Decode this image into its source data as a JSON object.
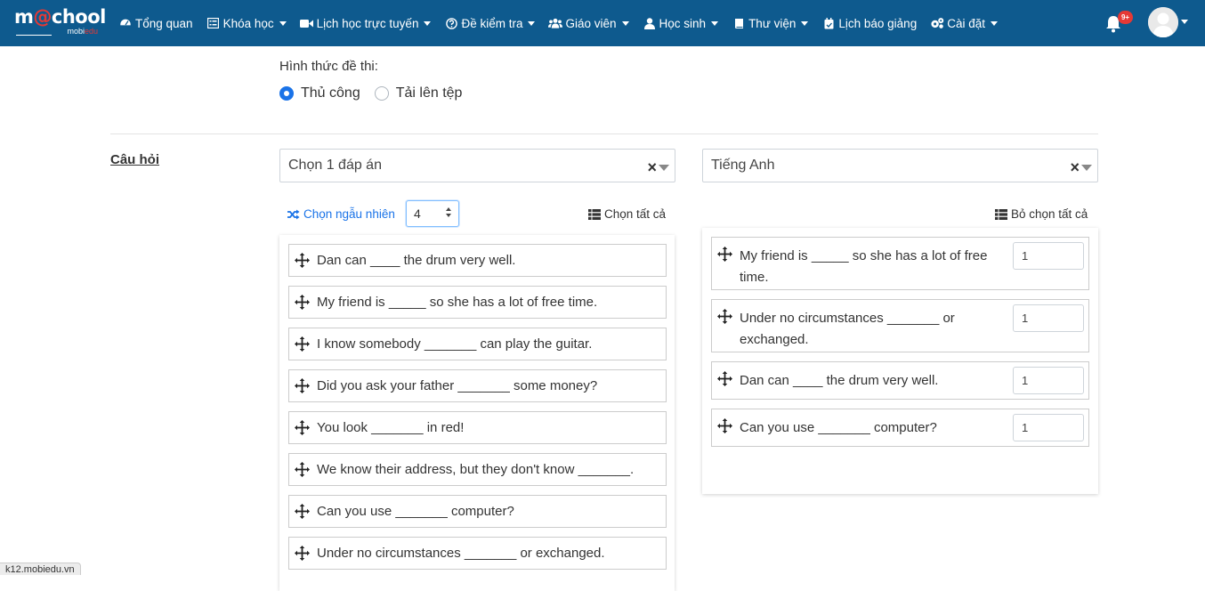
{
  "logo": {
    "brand_start": "m",
    "brand_o": "@",
    "brand_end": "chool",
    "sub_start": "mobi",
    "sub_end": "edu"
  },
  "nav": {
    "items": [
      {
        "label": "Tổng quan",
        "icon": "dashboard-icon",
        "caret": false
      },
      {
        "label": "Khóa học",
        "icon": "list-alt-icon",
        "caret": true
      },
      {
        "label": "Lịch học trực tuyến",
        "icon": "video-camera-icon",
        "caret": true
      },
      {
        "label": "Đề kiểm tra",
        "icon": "question-circle-icon",
        "caret": true
      },
      {
        "label": "Giáo viên",
        "icon": "users-icon",
        "caret": true
      },
      {
        "label": "Học sinh",
        "icon": "user-icon",
        "caret": true
      },
      {
        "label": "Thư viện",
        "icon": "book-icon",
        "caret": true
      },
      {
        "label": "Lịch báo giảng",
        "icon": "calendar-check-icon",
        "caret": false
      },
      {
        "label": "Cài đặt",
        "icon": "cogs-icon",
        "caret": true
      }
    ],
    "notification_badge": "9+"
  },
  "form": {
    "type_label": "Hình thức đề thi:",
    "radio_manual": "Thủ công",
    "radio_upload": "Tải lên tệp",
    "selected": "manual"
  },
  "questions": {
    "section_label": "Câu hỏi",
    "question_type_select": "Chọn 1 đáp án",
    "subject_select": "Tiếng Anh",
    "random_label": "Chọn ngẫu nhiên",
    "random_count": "4",
    "select_all_label": "Chọn tất cả",
    "deselect_all_label": "Bỏ chọn tất cả",
    "available": [
      "Dan can ____ the drum very well.",
      "My friend is _____ so she has a lot of free time.",
      "I know somebody _______ can play the guitar.",
      "Did you ask your father _______ some money?",
      "You look _______ in red!",
      "We know their address, but they don't know _______.",
      "Can you use _______ computer?",
      "Under no circumstances _______ or exchanged."
    ],
    "selected": [
      {
        "text": "My friend is _____ so she has a lot of free time.",
        "score": "1"
      },
      {
        "text": "Under no circumstances _______ or exchanged.",
        "score": "1"
      },
      {
        "text": "Dan can ____ the drum very well.",
        "score": "1"
      },
      {
        "text": "Can you use _______ computer?",
        "score": "1"
      }
    ]
  },
  "status_url": "k12.mobiedu.vn",
  "colors": {
    "navbar": "#0e5a8e",
    "accent": "#1a73e8",
    "badge": "#e53935"
  }
}
